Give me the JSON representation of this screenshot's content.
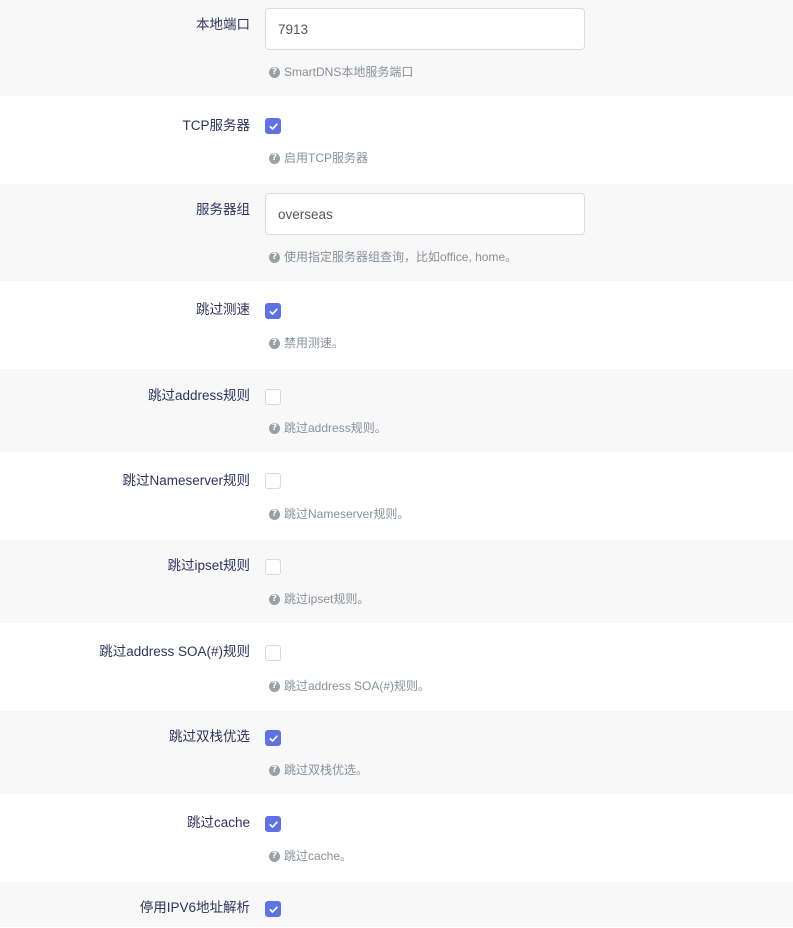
{
  "rows": [
    {
      "label": "本地端口",
      "type": "text",
      "value": "7913",
      "help": "SmartDNS本地服务端口"
    },
    {
      "label": "TCP服务器",
      "type": "checkbox",
      "checked": true,
      "help": "启用TCP服务器"
    },
    {
      "label": "服务器组",
      "type": "text",
      "value": "overseas",
      "help": "使用指定服务器组查询，比如office, home。"
    },
    {
      "label": "跳过测速",
      "type": "checkbox",
      "checked": true,
      "help": "禁用测速。"
    },
    {
      "label": "跳过address规则",
      "type": "checkbox",
      "checked": false,
      "help": "跳过address规则。"
    },
    {
      "label": "跳过Nameserver规则",
      "type": "checkbox",
      "checked": false,
      "help": "跳过Nameserver规则。"
    },
    {
      "label": "跳过ipset规则",
      "type": "checkbox",
      "checked": false,
      "help": "跳过ipset规则。"
    },
    {
      "label": "跳过address SOA(#)规则",
      "type": "checkbox",
      "checked": false,
      "help": "跳过address SOA(#)规则。"
    },
    {
      "label": "跳过双栈优选",
      "type": "checkbox",
      "checked": true,
      "help": "跳过双栈优选。"
    },
    {
      "label": "跳过cache",
      "type": "checkbox",
      "checked": true,
      "help": "跳过cache。"
    },
    {
      "label": "停用IPV6地址解析",
      "type": "checkbox",
      "checked": true,
      "help": ""
    }
  ],
  "colors": {
    "accent": "#5e72e4",
    "row_alt_bg": "#f8f8f8",
    "help_text": "#8a8f98"
  }
}
